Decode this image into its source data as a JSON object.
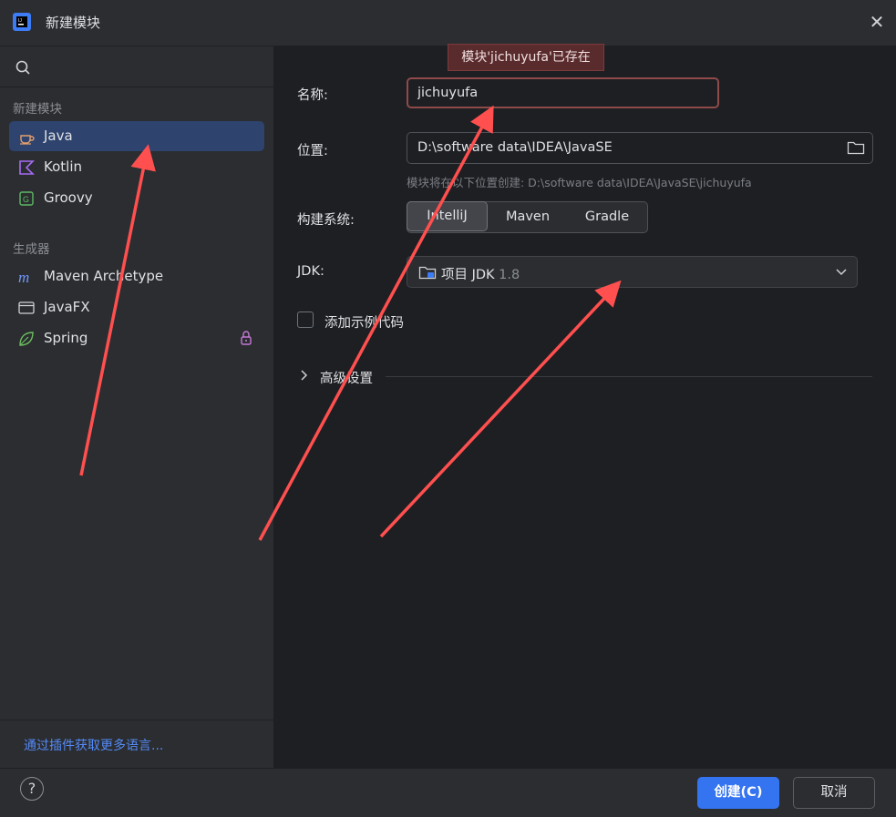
{
  "window": {
    "title": "新建模块",
    "close_glyph": "✕"
  },
  "sidebar": {
    "group_new_module": "新建模块",
    "items": [
      {
        "label": "Java",
        "icon": "java-cup-icon"
      },
      {
        "label": "Kotlin",
        "icon": "kotlin-icon"
      },
      {
        "label": "Groovy",
        "icon": "groovy-icon"
      }
    ],
    "group_generators": "生成器",
    "generators": [
      {
        "label": "Maven Archetype",
        "icon": "maven-icon"
      },
      {
        "label": "JavaFX",
        "icon": "javafx-icon"
      },
      {
        "label": "Spring",
        "icon": "spring-leaf-icon",
        "locked": true
      }
    ],
    "plugins_link": "通过插件获取更多语言..."
  },
  "form": {
    "name_label": "名称:",
    "name_value": "jichuyufa",
    "name_error": "模块'jichuyufa'已存在",
    "location_label": "位置:",
    "location_value": "D:\\software data\\IDEA\\JavaSE",
    "location_hint": "模块将在以下位置创建: D:\\software data\\IDEA\\JavaSE\\jichuyufa",
    "build_label": "构建系统:",
    "build_options": [
      "IntelliJ",
      "Maven",
      "Gradle"
    ],
    "build_selected": "IntelliJ",
    "jdk_label": "JDK:",
    "jdk_name": "项目 JDK",
    "jdk_version": "1.8",
    "sample_code_label": "添加示例代码",
    "sample_code_checked": false,
    "advanced_label": "高级设置"
  },
  "footer": {
    "help_glyph": "?",
    "create_label": "创建(C)",
    "cancel_label": "取消"
  },
  "colors": {
    "accent": "#3574f0",
    "selection": "#2e436e",
    "error_border": "#8f4a4a",
    "annotation_arrow": "#ff4f4f"
  }
}
